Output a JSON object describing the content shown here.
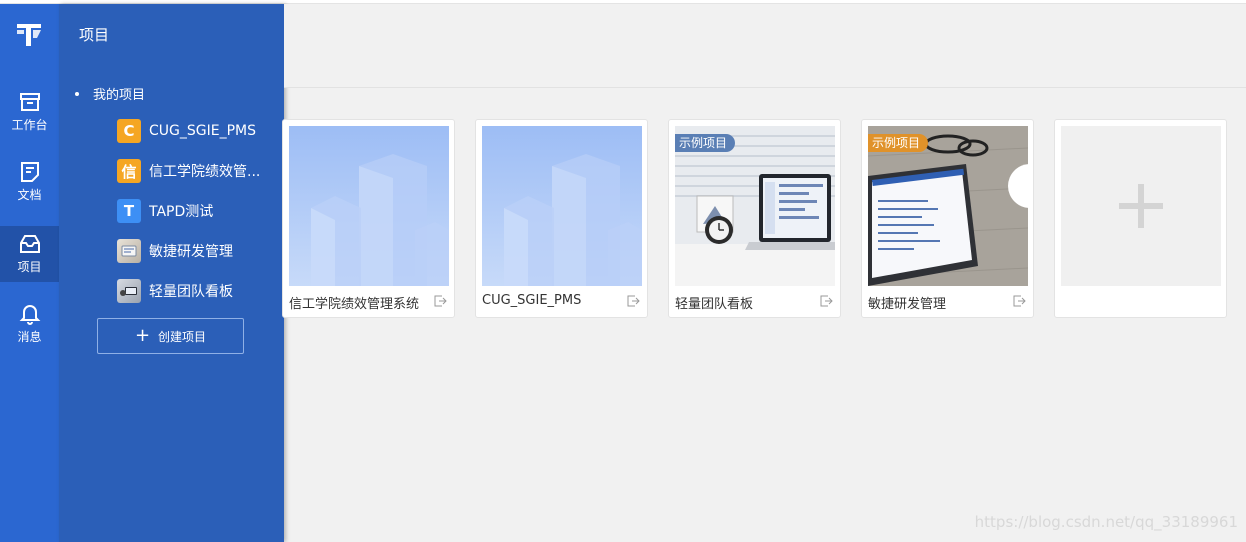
{
  "rail": {
    "items": [
      {
        "label": "工作台"
      },
      {
        "label": "文档"
      },
      {
        "label": "项目"
      },
      {
        "label": "消息"
      }
    ]
  },
  "panel": {
    "title": "项目",
    "section": "我的项目",
    "projects": [
      {
        "badge": "C",
        "name": "CUG_SGIE_PMS",
        "color": "#f5a623"
      },
      {
        "badge": "信",
        "name": "信工学院绩效管...",
        "color": "#f5a623"
      },
      {
        "badge": "T",
        "name": "TAPD测试",
        "color": "#3d8ff5"
      },
      {
        "badge": "",
        "name": "敏捷研发管理",
        "color": "#d9d4cc"
      },
      {
        "badge": "",
        "name": "轻量团队看板",
        "color": "#c9ced6"
      }
    ],
    "create_label": "创建项目"
  },
  "cards": [
    {
      "name": "信工学院绩效管理系统",
      "tag": ""
    },
    {
      "name": "CUG_SGIE_PMS",
      "tag": ""
    },
    {
      "name": "轻量团队看板",
      "tag": "示例项目",
      "tag_color": "#5a7fb5"
    },
    {
      "name": "敏捷研发管理",
      "tag": "示例项目",
      "tag_color": "#e0922a"
    }
  ],
  "watermark": "https://blog.csdn.net/qq_33189961"
}
